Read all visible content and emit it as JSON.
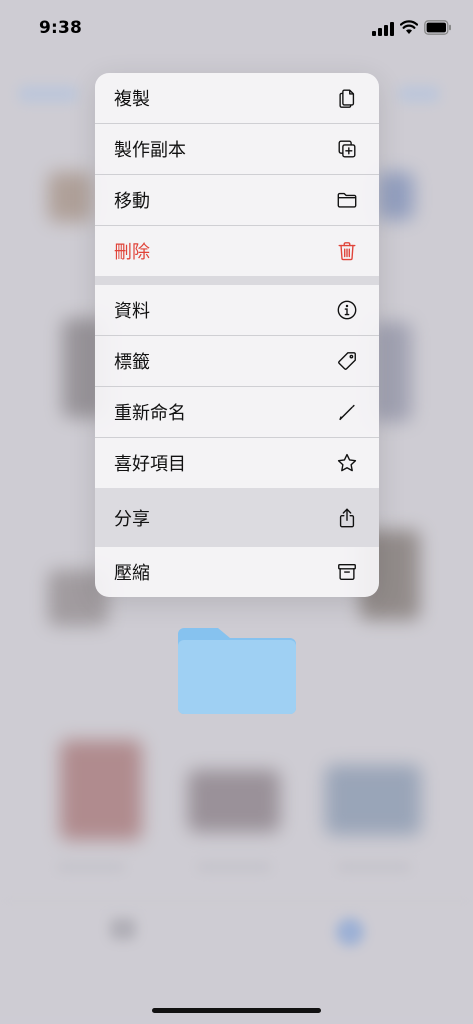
{
  "status_bar": {
    "time": "9:38"
  },
  "menu": {
    "group1": [
      {
        "label": "複製",
        "icon": "doc-copy-icon"
      },
      {
        "label": "製作副本",
        "icon": "plus-square-on-square-icon"
      },
      {
        "label": "移動",
        "icon": "folder-icon"
      },
      {
        "label": "刪除",
        "icon": "trash-icon",
        "destructive": true
      }
    ],
    "group2": [
      {
        "label": "資料",
        "icon": "info-circle-icon"
      },
      {
        "label": "標籤",
        "icon": "tag-icon"
      },
      {
        "label": "重新命名",
        "icon": "pencil-icon"
      },
      {
        "label": "喜好項目",
        "icon": "star-icon"
      },
      {
        "label": "分享",
        "icon": "share-icon",
        "highlighted": true
      },
      {
        "label": "壓縮",
        "icon": "archive-box-icon"
      }
    ]
  },
  "colors": {
    "destructive": "#e0443a",
    "folder_blue": "#9fd0f3",
    "folder_tab": "#86c2ef",
    "menu_background": "#f6f5f8"
  },
  "preview": {
    "type": "folder",
    "icon": "folder-icon"
  }
}
